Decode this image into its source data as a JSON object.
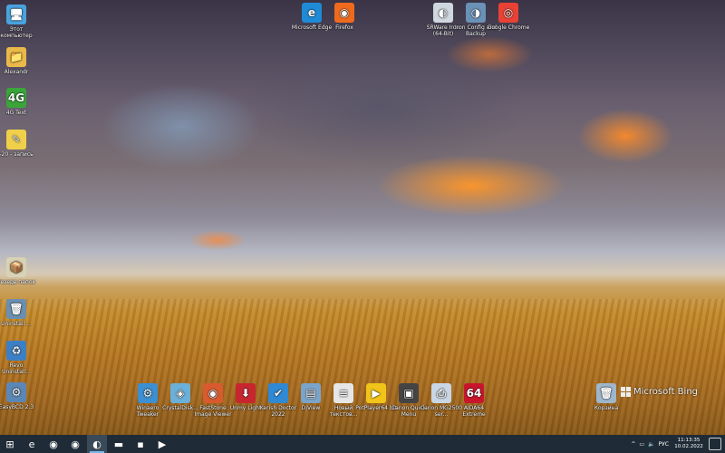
{
  "desktop": {
    "left_icons": [
      {
        "name": "this-pc-icon",
        "label": "Этот компьютер",
        "symbol": "🖥",
        "bg": "#4aa3df"
      },
      {
        "name": "user-folder-icon",
        "label": "Alexandr",
        "symbol": "📁",
        "bg": "#e9b949"
      },
      {
        "name": "4g-icon",
        "label": "4G Text",
        "symbol": "4G",
        "bg": "#3aa63a"
      },
      {
        "name": "sticky-note-icon",
        "label": "-20 - запись",
        "symbol": "✎",
        "bg": "#f0d04a"
      },
      {
        "name": "installer-icon",
        "label": "Резерв папок",
        "symbol": "📦",
        "bg": "#d9d2b5"
      },
      {
        "name": "uninstaller-icon",
        "label": "Uninstall ...",
        "symbol": "🗑",
        "bg": "#6b8fb0"
      },
      {
        "name": "revo-uninstaller-icon",
        "label": "Revo Uninstall...",
        "symbol": "♻",
        "bg": "#3d7fc4"
      },
      {
        "name": "easybcd-icon",
        "label": "EasyBCD 2.3",
        "symbol": "⚙",
        "bg": "#5a87b5"
      }
    ],
    "top_icons": [
      {
        "name": "microsoft-edge-icon",
        "label": "Microsoft Edge",
        "symbol": "e",
        "bg": "#1f8ad6"
      },
      {
        "name": "firefox-icon",
        "label": "Firefox",
        "symbol": "◉",
        "bg": "#f06a1e"
      },
      {
        "name": "srware-iron-icon",
        "label": "SRWare Iron (64-Bit)",
        "symbol": "◐",
        "bg": "#cfd7df"
      },
      {
        "name": "iron-config-icon",
        "label": "Iron Config and Backup",
        "symbol": "◑",
        "bg": "#6a91b6"
      },
      {
        "name": "google-chrome-icon",
        "label": "Google Chrome",
        "symbol": "◎",
        "bg": "#e94235"
      }
    ],
    "bottom_icons": [
      {
        "name": "winaero-tweaker-icon",
        "label": "Winaero Tweaker",
        "symbol": "⚙",
        "bg": "#3c8fd1"
      },
      {
        "name": "crystaldiskinfo-icon",
        "label": "CrystalDisk...",
        "symbol": "◈",
        "bg": "#6bb0d8"
      },
      {
        "name": "faststone-icon",
        "label": "FastStone Image Viewer",
        "symbol": "◉",
        "bg": "#d85a2e"
      },
      {
        "name": "uninstall-tool-icon",
        "label": "Unmy Light",
        "symbol": "⬇",
        "bg": "#c7262f"
      },
      {
        "name": "kerish-doctor-icon",
        "label": "Kerish Doctor 2022",
        "symbol": "✔",
        "bg": "#2f89d4"
      },
      {
        "name": "djview-icon",
        "label": "DjView",
        "symbol": "▤",
        "bg": "#7aa4c9"
      },
      {
        "name": "new-text-document-icon",
        "label": "Новый текстов...",
        "symbol": "≡",
        "bg": "#e6e6e6"
      },
      {
        "name": "potplayer-icon",
        "label": "PotPlayer64 bit",
        "symbol": "▶",
        "bg": "#f0c419"
      },
      {
        "name": "canon-quick-menu-icon",
        "label": "Canon Quick Menu",
        "symbol": "▣",
        "bg": "#444444"
      },
      {
        "name": "canon-printer-icon",
        "label": "Canon MG2500 ser...",
        "symbol": "⎙",
        "bg": "#c8d6e5"
      },
      {
        "name": "aida64-icon",
        "label": "AIDA64 Extreme",
        "symbol": "64",
        "bg": "#c9152c"
      }
    ],
    "recycle_bin": {
      "name": "recycle-bin-icon",
      "label": "Корзина",
      "symbol": "🗑",
      "bg": "#9fb7cc"
    },
    "watermark": "Microsoft Bing"
  },
  "taskbar": {
    "items": [
      {
        "name": "start-button-icon",
        "symbol": "⊞",
        "active": false
      },
      {
        "name": "ie-taskbar-icon",
        "symbol": "e",
        "active": false
      },
      {
        "name": "edge-taskbar-icon",
        "symbol": "◉",
        "active": false
      },
      {
        "name": "firefox-taskbar-icon",
        "symbol": "◉",
        "active": false
      },
      {
        "name": "iron-taskbar-icon",
        "symbol": "◐",
        "active": true
      },
      {
        "name": "explorer-taskbar-icon",
        "symbol": "▬",
        "active": false
      },
      {
        "name": "sticky-notes-taskbar-icon",
        "symbol": "▪",
        "active": false
      },
      {
        "name": "youtube-taskbar-icon",
        "symbol": "▶",
        "active": false
      }
    ],
    "tray": {
      "chevron": "^",
      "lang": "РУС",
      "time": "11:13:35",
      "date": "10.02.2022"
    }
  },
  "colors": {
    "taskbar_bg": "#1f2b36",
    "active_indicator": "#76b9ed"
  }
}
